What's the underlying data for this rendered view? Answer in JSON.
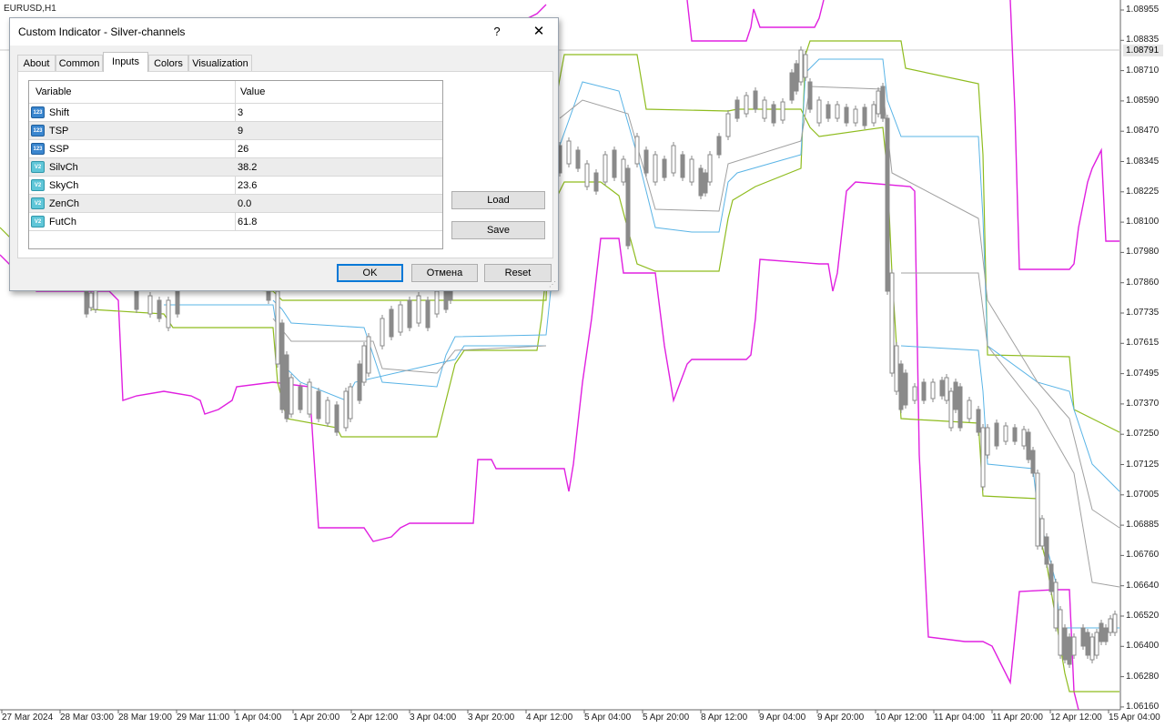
{
  "chart": {
    "symbol": "EURUSD,H1",
    "current_price": "1.08791",
    "price_labels": [
      "1.08955",
      "1.08835",
      "1.08710",
      "1.08590",
      "1.08470",
      "1.08345",
      "1.08225",
      "1.08100",
      "1.07980",
      "1.07860",
      "1.07735",
      "1.07615",
      "1.07495",
      "1.07370",
      "1.07250",
      "1.07125",
      "1.07005",
      "1.06885",
      "1.06760",
      "1.06640",
      "1.06520",
      "1.06400",
      "1.06280",
      "1.06160"
    ],
    "time_labels": [
      "27 Mar 2024",
      "28 Mar 03:00",
      "28 Mar 19:00",
      "29 Mar 11:00",
      "1 Apr 04:00",
      "1 Apr 20:00",
      "2 Apr 12:00",
      "3 Apr 04:00",
      "3 Apr 20:00",
      "4 Apr 12:00",
      "5 Apr 04:00",
      "5 Apr 20:00",
      "8 Apr 12:00",
      "9 Apr 04:00",
      "9 Apr 20:00",
      "10 Apr 12:00",
      "11 Apr 04:00",
      "11 Apr 20:00",
      "12 Apr 12:00",
      "15 Apr 04:00"
    ],
    "colors": {
      "magenta": "#e020e0",
      "olive": "#8fbc1f",
      "blue": "#5ab4e6",
      "gray": "#a0a0a0",
      "candle": "#8a8a8a"
    }
  },
  "dialog": {
    "title": "Custom Indicator - Silver-channels",
    "help_label": "?",
    "close_label": "✕",
    "tabs": [
      {
        "label": "About"
      },
      {
        "label": "Common"
      },
      {
        "label": "Inputs"
      },
      {
        "label": "Colors"
      },
      {
        "label": "Visualization"
      }
    ],
    "active_tab": "Inputs",
    "table": {
      "headers": {
        "variable": "Variable",
        "value": "Value"
      },
      "rows": [
        {
          "icon": "int-icon",
          "icon_text": "123",
          "name": "Shift",
          "value": "3"
        },
        {
          "icon": "int-icon",
          "icon_text": "123",
          "name": "TSP",
          "value": "9"
        },
        {
          "icon": "int-icon",
          "icon_text": "123",
          "name": "SSP",
          "value": "26"
        },
        {
          "icon": "double-icon",
          "icon_text": "V2",
          "name": "SilvCh",
          "value": "38.2"
        },
        {
          "icon": "double-icon",
          "icon_text": "V2",
          "name": "SkyCh",
          "value": "23.6"
        },
        {
          "icon": "double-icon",
          "icon_text": "V2",
          "name": "ZenCh",
          "value": "0.0"
        },
        {
          "icon": "double-icon",
          "icon_text": "V2",
          "name": "FutCh",
          "value": "61.8"
        }
      ]
    },
    "load_label": "Load",
    "save_label": "Save",
    "ok_label": "OK",
    "cancel_label": "Отмена",
    "reset_label": "Reset"
  }
}
